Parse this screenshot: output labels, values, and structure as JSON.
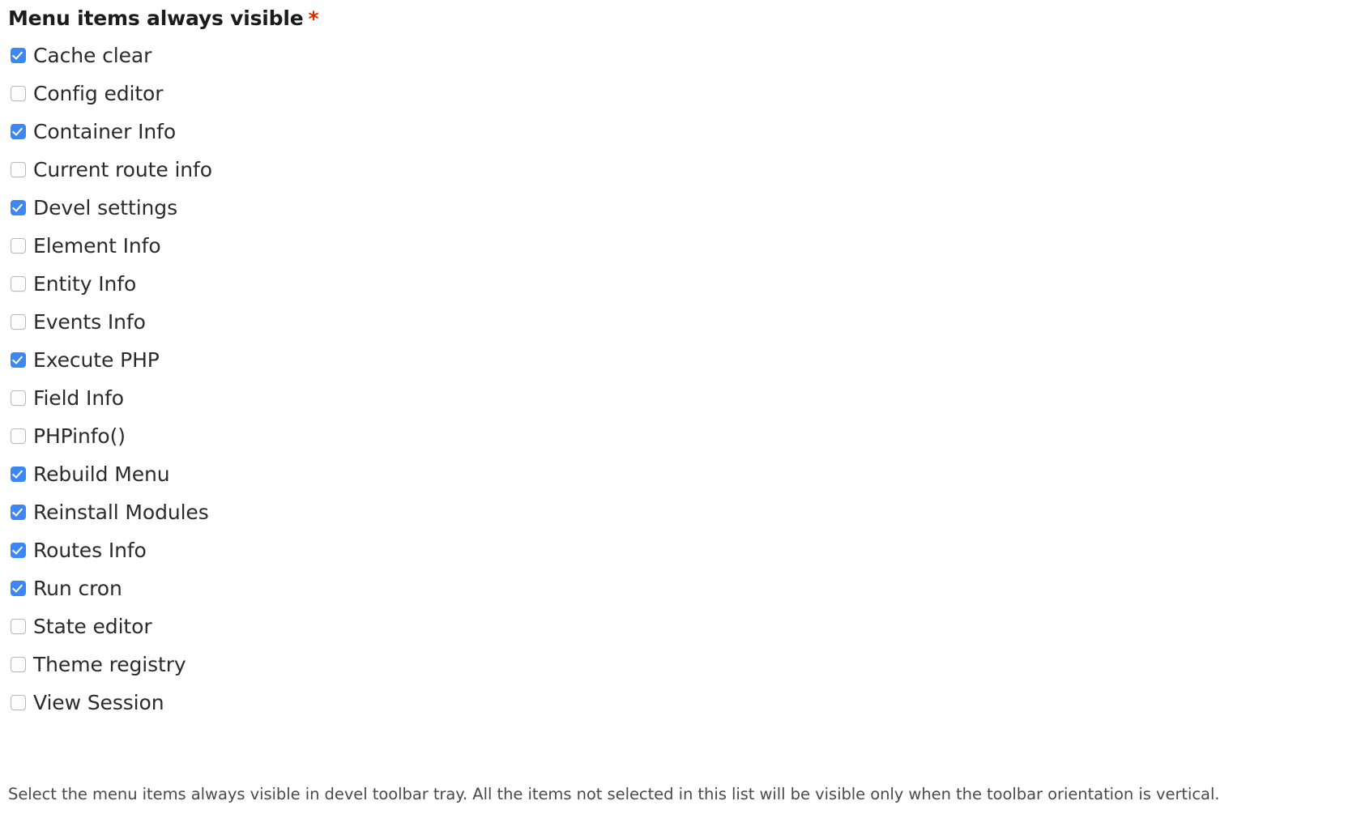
{
  "field": {
    "label": "Menu items always visible",
    "required_marker": "*",
    "required_color": "#e32700",
    "accent_color": "#3b87f5",
    "description": "Select the menu items always visible in devel toolbar tray. All the items not selected in this list will be visible only when the toolbar orientation is vertical."
  },
  "options": [
    {
      "label": "Cache clear",
      "checked": true
    },
    {
      "label": "Config editor",
      "checked": false
    },
    {
      "label": "Container Info",
      "checked": true
    },
    {
      "label": "Current route info",
      "checked": false
    },
    {
      "label": "Devel settings",
      "checked": true
    },
    {
      "label": "Element Info",
      "checked": false
    },
    {
      "label": "Entity Info",
      "checked": false
    },
    {
      "label": "Events Info",
      "checked": false
    },
    {
      "label": "Execute PHP",
      "checked": true
    },
    {
      "label": "Field Info",
      "checked": false
    },
    {
      "label": "PHPinfo()",
      "checked": false
    },
    {
      "label": "Rebuild Menu",
      "checked": true
    },
    {
      "label": "Reinstall Modules",
      "checked": true
    },
    {
      "label": "Routes Info",
      "checked": true
    },
    {
      "label": "Run cron",
      "checked": true
    },
    {
      "label": "State editor",
      "checked": false
    },
    {
      "label": "Theme registry",
      "checked": false
    },
    {
      "label": "View Session",
      "checked": false
    }
  ]
}
